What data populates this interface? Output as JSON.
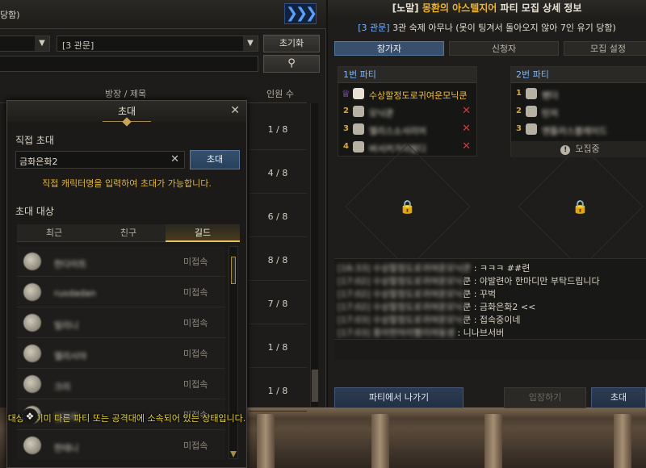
{
  "left": {
    "top_label": "당함)",
    "filter_select": "[3 관문]",
    "reset_label": "초기화",
    "col_title": "방장 / 제목",
    "col_count": "인원 수",
    "counts": [
      "1 / 8",
      "4 / 8",
      "6 / 8",
      "8 / 8",
      "7 / 8",
      "1 / 8",
      "1 / 8"
    ]
  },
  "right": {
    "title_pre": "[노말]",
    "title_hl": "몽환의 아스텔지어",
    "title_post": "파티 모집 상세 정보",
    "sub_tag": "[3 관문]",
    "sub_text": "3관 숙제 아무나 (못이 팅겨서 돌아오지 않아 7인 유기 당함)",
    "tabs": [
      "참가자",
      "신청자",
      "모집 설정"
    ],
    "party1": {
      "label": "1번 파티",
      "leader": "수상할정도로귀여운모닉쿤",
      "members": [
        {
          "num": "2",
          "name": "모닉쿤"
        },
        {
          "num": "3",
          "name": "엘리스소서리어"
        },
        {
          "num": "4",
          "name": "버서커가리발디"
        }
      ]
    },
    "party2": {
      "label": "2번 파티",
      "members": [
        {
          "num": "1",
          "name": "팬더"
        },
        {
          "num": "2",
          "name": "탄저"
        },
        {
          "num": "3",
          "name": "앤틀러스블레이드"
        }
      ],
      "recruiting": "모집중"
    },
    "chat": [
      {
        "who": "[16:33] 수상할정도로귀여운모닉쿤",
        "msg": ": ㅋㅋㅋ ##련"
      },
      {
        "who": "[17:02] 수상할정도로귀여운모닉",
        "msg": "쿤 : 야발련아 한마디만 부탁드립니다"
      },
      {
        "who": "[17:02] 수상할정도로귀여운모닉",
        "msg": "쿤 : 꾸벅"
      },
      {
        "who": "[17:02] 수상할정도로귀여운모닉",
        "msg": "쿤 : 금화은화2 <<"
      },
      {
        "who": "[17:03] 수상할정도로귀여운모닉",
        "msg": "쿤 : 접속중이네"
      },
      {
        "who": "[17:03] 풍아한마리빨리여동생",
        "msg": ": 니나브서버"
      }
    ],
    "leave_label": "파티에서 나가기",
    "enter_label": "입장하기",
    "invite_label": "초대"
  },
  "invite": {
    "title": "초대",
    "direct_title": "직접 초대",
    "name_value": "금화은화2",
    "invite_btn": "초대",
    "hint": "직접 캐릭터명을 입력하여 초대가 가능합니다.",
    "target_title": "초대 대상",
    "tabs": [
      "최근",
      "친구",
      "길드"
    ],
    "rows": [
      {
        "name": "한다이트",
        "status": "미접속"
      },
      {
        "name": "rusdadan",
        "status": "미접속"
      },
      {
        "name": "빌리니",
        "status": "미접속"
      },
      {
        "name": "엘리시아",
        "status": "미접속"
      },
      {
        "name": "크리",
        "status": "미접속"
      },
      {
        "name": "빌블랙",
        "status": "미접속"
      },
      {
        "name": "한테니",
        "status": "미접속"
      }
    ],
    "warning": "대상이 이미 다른 파티 또는 공격대에 소속되어 있는 상태입니다."
  }
}
